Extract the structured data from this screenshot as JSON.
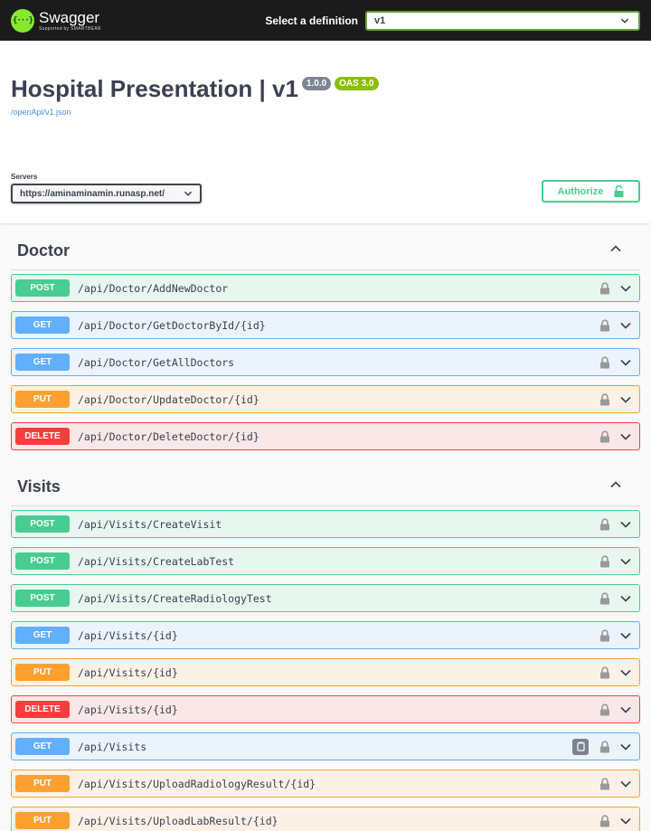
{
  "topbar": {
    "brand": "Swagger",
    "brand_sub": "Supported by SMARTBEAR",
    "logo_glyph": "{···}",
    "definition_label": "Select a definition",
    "definition_value": "v1"
  },
  "info": {
    "title": "Hospital Presentation | v1",
    "version_badge": "1.0.0",
    "oas_badge": "OAS 3.0",
    "spec_link": "/openApi/v1.json"
  },
  "servers": {
    "label": "Servers",
    "selected": "https://aminaminamin.runasp.net/",
    "authorize_label": "Authorize"
  },
  "colors": {
    "post": "#49cc90",
    "get": "#61affe",
    "put": "#fca130",
    "delete": "#f93e3e",
    "topbar": "#1b1b1b",
    "definition_border": "#62a03f"
  },
  "tags": [
    {
      "name": "Doctor",
      "operations": [
        {
          "method": "POST",
          "path": "/api/Doctor/AddNewDoctor"
        },
        {
          "method": "GET",
          "path": "/api/Doctor/GetDoctorById/{id}"
        },
        {
          "method": "GET",
          "path": "/api/Doctor/GetAllDoctors"
        },
        {
          "method": "PUT",
          "path": "/api/Doctor/UpdateDoctor/{id}"
        },
        {
          "method": "DELETE",
          "path": "/api/Doctor/DeleteDoctor/{id}"
        }
      ]
    },
    {
      "name": "Visits",
      "operations": [
        {
          "method": "POST",
          "path": "/api/Visits/CreateVisit"
        },
        {
          "method": "POST",
          "path": "/api/Visits/CreateLabTest"
        },
        {
          "method": "POST",
          "path": "/api/Visits/CreateRadiologyTest"
        },
        {
          "method": "GET",
          "path": "/api/Visits/{id}"
        },
        {
          "method": "PUT",
          "path": "/api/Visits/{id}"
        },
        {
          "method": "DELETE",
          "path": "/api/Visits/{id}"
        },
        {
          "method": "GET",
          "path": "/api/Visits",
          "copy_icon": "copy-to-clipboard-icon"
        },
        {
          "method": "PUT",
          "path": "/api/Visits/UploadRadiologyResult/{id}"
        },
        {
          "method": "PUT",
          "path": "/api/Visits/UploadLabResult/{id}"
        }
      ]
    }
  ]
}
